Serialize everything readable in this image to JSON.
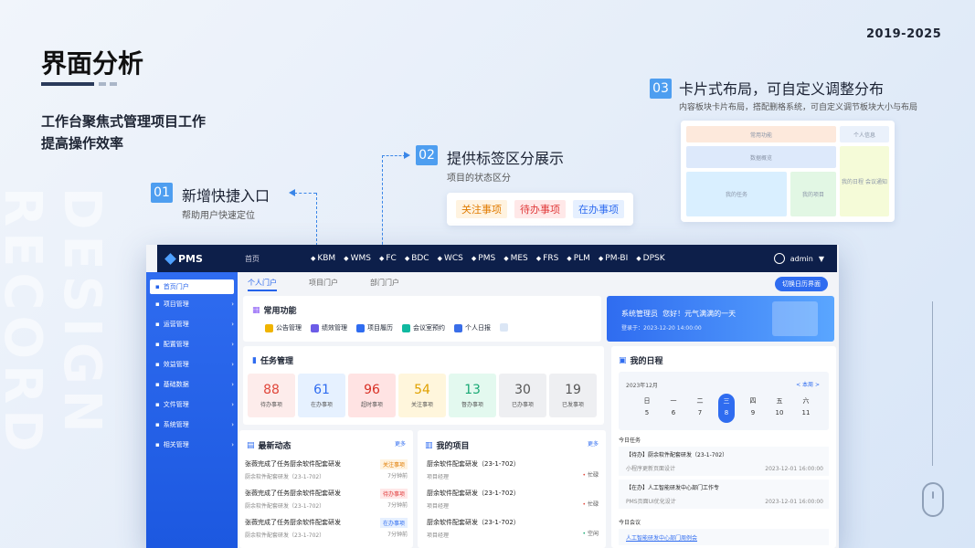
{
  "header": {
    "year": "2019-2025",
    "title": "界面分析",
    "subtitle_line1": "工作台聚焦式管理项目工作",
    "subtitle_line2": "提高操作效率"
  },
  "watermark": "DESIGN RECORD",
  "features": [
    {
      "num": "01",
      "title": "新增快捷入口",
      "desc": "帮助用户快速定位"
    },
    {
      "num": "02",
      "title": "提供标签区分展示",
      "desc": "项目的状态区分",
      "tags": [
        "关注事项",
        "待办事项",
        "在办事项"
      ]
    },
    {
      "num": "03",
      "title": "卡片式布局，可自定义调整分布",
      "desc": "内容板块卡片布局，搭配删格系统，可自定义调节板块大小与布局",
      "cells": [
        "常用功能",
        "个人信息",
        "数据概览",
        "我的任务",
        "我的项目",
        "我的日程 会议通知"
      ]
    }
  ],
  "colors": {
    "accent": "#3a86e8",
    "nav": "#0d1f4a",
    "sidebar": "#2563eb"
  },
  "app": {
    "logo": "PMS",
    "home": "首页",
    "nav": [
      {
        "icon": "kbm-icon",
        "label": "KBM"
      },
      {
        "icon": "wms-icon",
        "label": "WMS"
      },
      {
        "icon": "fc-icon",
        "label": "FC"
      },
      {
        "icon": "bdc-icon",
        "label": "BDC"
      },
      {
        "icon": "wcs-icon",
        "label": "WCS"
      },
      {
        "icon": "pms-icon",
        "label": "PMS"
      },
      {
        "icon": "mes-icon",
        "label": "MES"
      },
      {
        "icon": "frs-icon",
        "label": "FRS"
      },
      {
        "icon": "plm-icon",
        "label": "PLM"
      },
      {
        "icon": "pmbi-icon",
        "label": "PM-BI"
      },
      {
        "icon": "dpsk-icon",
        "label": "DPSK"
      }
    ],
    "user": "admin",
    "sidebar": [
      "首页门户",
      "项目管理",
      "运营管理",
      "配置管理",
      "效益管理",
      "基础数据",
      "文件管理",
      "系统管理",
      "相关管理"
    ],
    "tabs": [
      "个人门户",
      "项目门户",
      "部门门户"
    ],
    "switch_btn": "切换日历界面",
    "quick": {
      "title": "常用功能",
      "items": [
        "公告管理",
        "绩效管理",
        "项目履历",
        "会议室预约",
        "个人日报"
      ]
    },
    "banner": {
      "role": "系统管理员",
      "greet": "您好！元气满满的一天",
      "login": "登录于：2023-12-20 14:00:00"
    },
    "tasks": {
      "title": "任务管理",
      "stats": [
        {
          "n": "88",
          "l": "待办事项"
        },
        {
          "n": "61",
          "l": "在办事项"
        },
        {
          "n": "96",
          "l": "超时事项"
        },
        {
          "n": "54",
          "l": "关注事项"
        },
        {
          "n": "13",
          "l": "督办事项"
        },
        {
          "n": "30",
          "l": "已办事项"
        },
        {
          "n": "19",
          "l": "已发事项"
        }
      ]
    },
    "schedule": {
      "title": "我的日程",
      "month": "2023年12月",
      "this_week": "< 本周 >",
      "weekdays": [
        "日",
        "一",
        "二",
        "三",
        "四",
        "五",
        "六"
      ],
      "dates": [
        "5",
        "6",
        "7",
        "8",
        "9",
        "10",
        "11"
      ],
      "today_task_label": "今日任务",
      "tasks": [
        {
          "t": "【待办】厨余软件配套研发（23-1-702）",
          "s": "小程序更新页面设计",
          "d": "2023-12-01  16:00:00"
        },
        {
          "t": "【在办】人工智能研发中心部门工作专",
          "s": "PMS页面UI优化设计",
          "d": "2023-12-01  16:00:00"
        }
      ],
      "meeting_label": "今日会议",
      "meeting": "人工智能研发中心部门周例会"
    },
    "news": {
      "title": "最新动态",
      "more": "更多",
      "items": [
        {
          "t": "张薇完成了任务厨余软件配套研发",
          "s": "厨余软件配套研发（23-1-702）",
          "tag": "关注事项",
          "time": "7分钟前"
        },
        {
          "t": "张薇完成了任务厨余软件配套研发",
          "s": "厨余软件配套研发（23-1-702）",
          "tag": "待办事项",
          "time": "7分钟前"
        },
        {
          "t": "张薇完成了任务厨余软件配套研发",
          "s": "厨余软件配套研发（23-1-702）",
          "tag": "在办事项",
          "time": "7分钟前"
        }
      ]
    },
    "projects": {
      "title": "我的项目",
      "more": "更多",
      "items": [
        {
          "t": "厨余软件配套研发（23-1-702）",
          "s": "项目经理",
          "st": "忙碌"
        },
        {
          "t": "厨余软件配套研发（23-1-702）",
          "s": "项目经理",
          "st": "忙碌"
        },
        {
          "t": "厨余软件配套研发（23-1-702）",
          "s": "项目经理",
          "st": "空闲"
        }
      ]
    }
  }
}
